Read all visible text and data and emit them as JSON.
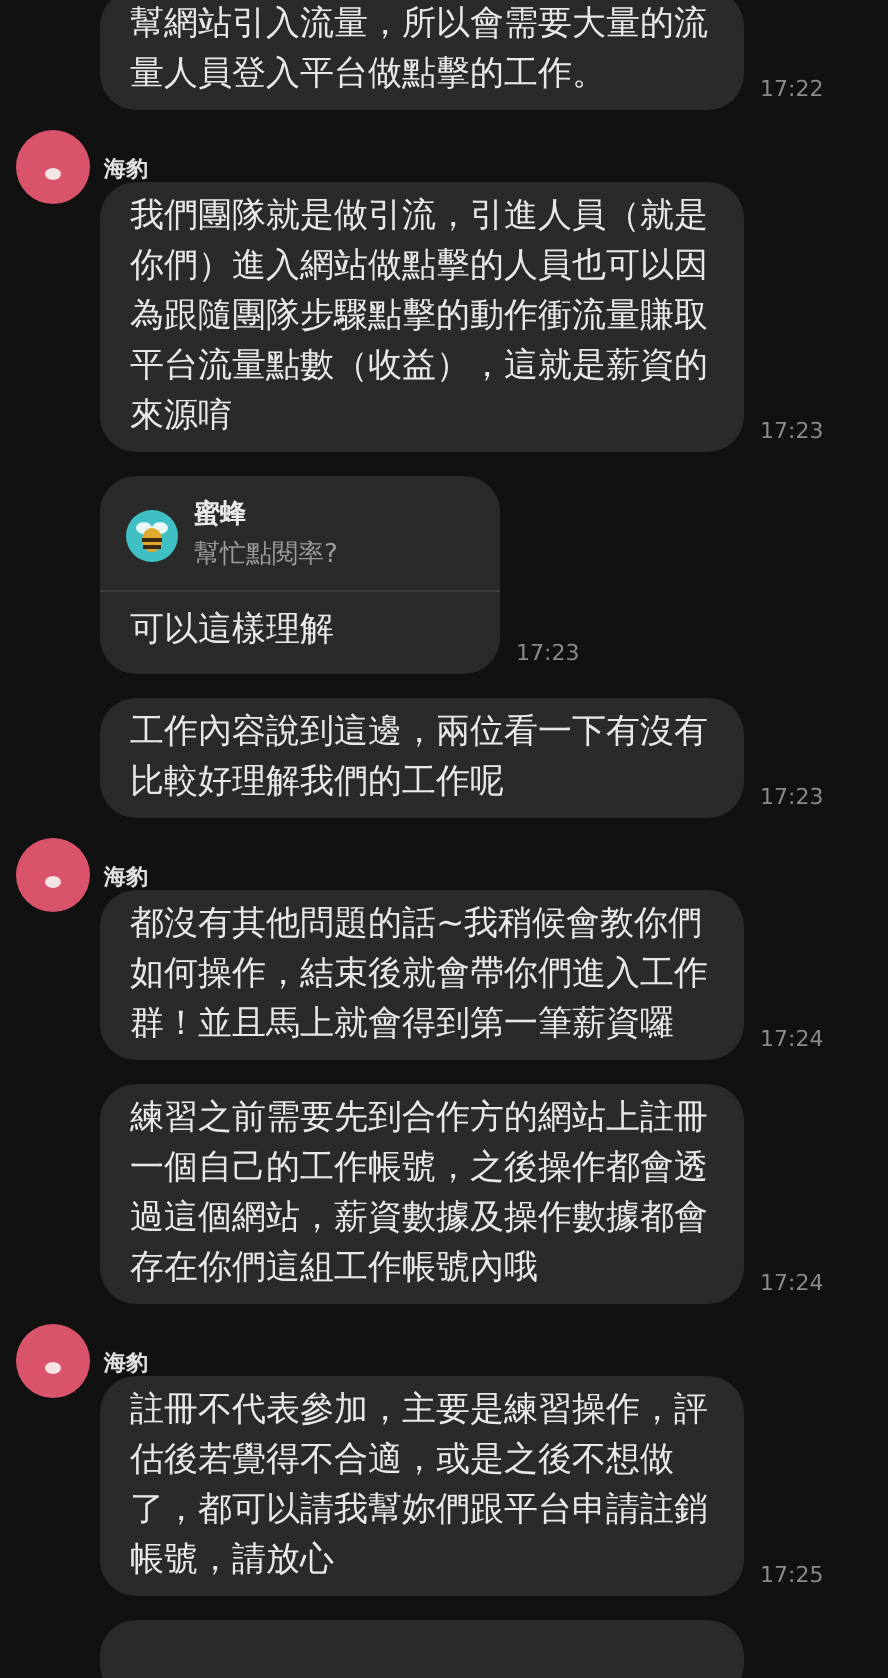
{
  "chat": [
    {
      "kind": "message",
      "text": "幫網站引入流量，所以會需要大量的流量人員登入平台做點擊的工作。",
      "time": "17:22"
    },
    {
      "kind": "sender",
      "name": "海豹"
    },
    {
      "kind": "message",
      "text": "我們團隊就是做引流，引進人員（就是你們）進入網站做點擊的人員也可以因為跟隨團隊步驟點擊的動作衝流量賺取平台流量點數（收益），這就是薪資的來源唷",
      "time": "17:23"
    },
    {
      "kind": "reply",
      "quote_name": "蜜蜂",
      "quote_text": "幫忙點閱率?",
      "text": "可以這樣理解",
      "time": "17:23"
    },
    {
      "kind": "message",
      "text": "工作內容說到這邊，兩位看一下有沒有比較好理解我們的工作呢",
      "time": "17:23"
    },
    {
      "kind": "sender",
      "name": "海豹"
    },
    {
      "kind": "message",
      "text": "都沒有其他問題的話~我稍候會教你們如何操作，結束後就會帶你們進入工作群！並且馬上就會得到第一筆薪資囉",
      "time": "17:24"
    },
    {
      "kind": "message",
      "text": "練習之前需要先到合作方的網站上註冊一個自己的工作帳號，之後操作都會透過這個網站，薪資數據及操作數據都會存在你們這組工作帳號內哦",
      "time": "17:24"
    },
    {
      "kind": "sender",
      "name": "海豹"
    },
    {
      "kind": "message",
      "text": "註冊不代表參加，主要是練習操作，評估後若覺得不合適，或是之後不想做了，都可以請我幫妳們跟平台申請註銷帳號，請放心",
      "time": "17:25"
    },
    {
      "kind": "cutoff"
    }
  ]
}
